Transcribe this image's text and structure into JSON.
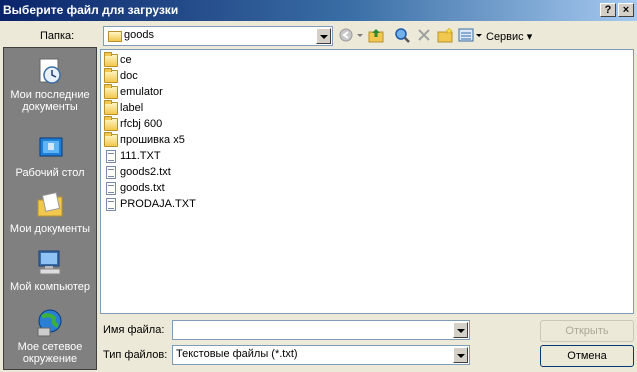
{
  "window": {
    "title": "Выберите файл для загрузки",
    "help_button": "?",
    "close_button": "×"
  },
  "lookin": {
    "label": "Папка:",
    "value": "goods",
    "icon": "folder-icon"
  },
  "toolbar": {
    "back_icon": "back-icon",
    "up_icon": "up-folder-icon",
    "search_icon": "search-web-icon",
    "delete_icon": "delete-icon",
    "new_folder_icon": "new-folder-icon",
    "views_icon": "views-menu-icon",
    "tools_label": "Сервис"
  },
  "places": [
    {
      "label": "Мои последние документы",
      "icon": "recent-documents-icon"
    },
    {
      "label": "Рабочий стол",
      "icon": "desktop-icon"
    },
    {
      "label": "Мои документы",
      "icon": "my-documents-icon"
    },
    {
      "label": "Мой компьютер",
      "icon": "my-computer-icon"
    },
    {
      "label": "Мое сетевое окружение",
      "icon": "network-places-icon"
    }
  ],
  "files": [
    {
      "name": "ce",
      "type": "folder"
    },
    {
      "name": "doc",
      "type": "folder"
    },
    {
      "name": "emulator",
      "type": "folder"
    },
    {
      "name": "label",
      "type": "folder"
    },
    {
      "name": "rfcbj 600",
      "type": "folder"
    },
    {
      "name": "прошивка x5",
      "type": "folder"
    },
    {
      "name": "111.TXT",
      "type": "file"
    },
    {
      "name": "goods2.txt",
      "type": "file"
    },
    {
      "name": "goods.txt",
      "type": "file"
    },
    {
      "name": "PRODAJA.TXT",
      "type": "file"
    }
  ],
  "filename": {
    "label": "Имя файла:",
    "value": ""
  },
  "filetype": {
    "label": "Тип файлов:",
    "value": "Текстовые файлы (*.txt)"
  },
  "buttons": {
    "open": "Открыть",
    "cancel": "Отмена"
  },
  "colors": {
    "title_start": "#0a246a",
    "title_end": "#a6caf0",
    "places_bg": "#808080",
    "dialog_bg": "#ece9d8"
  }
}
